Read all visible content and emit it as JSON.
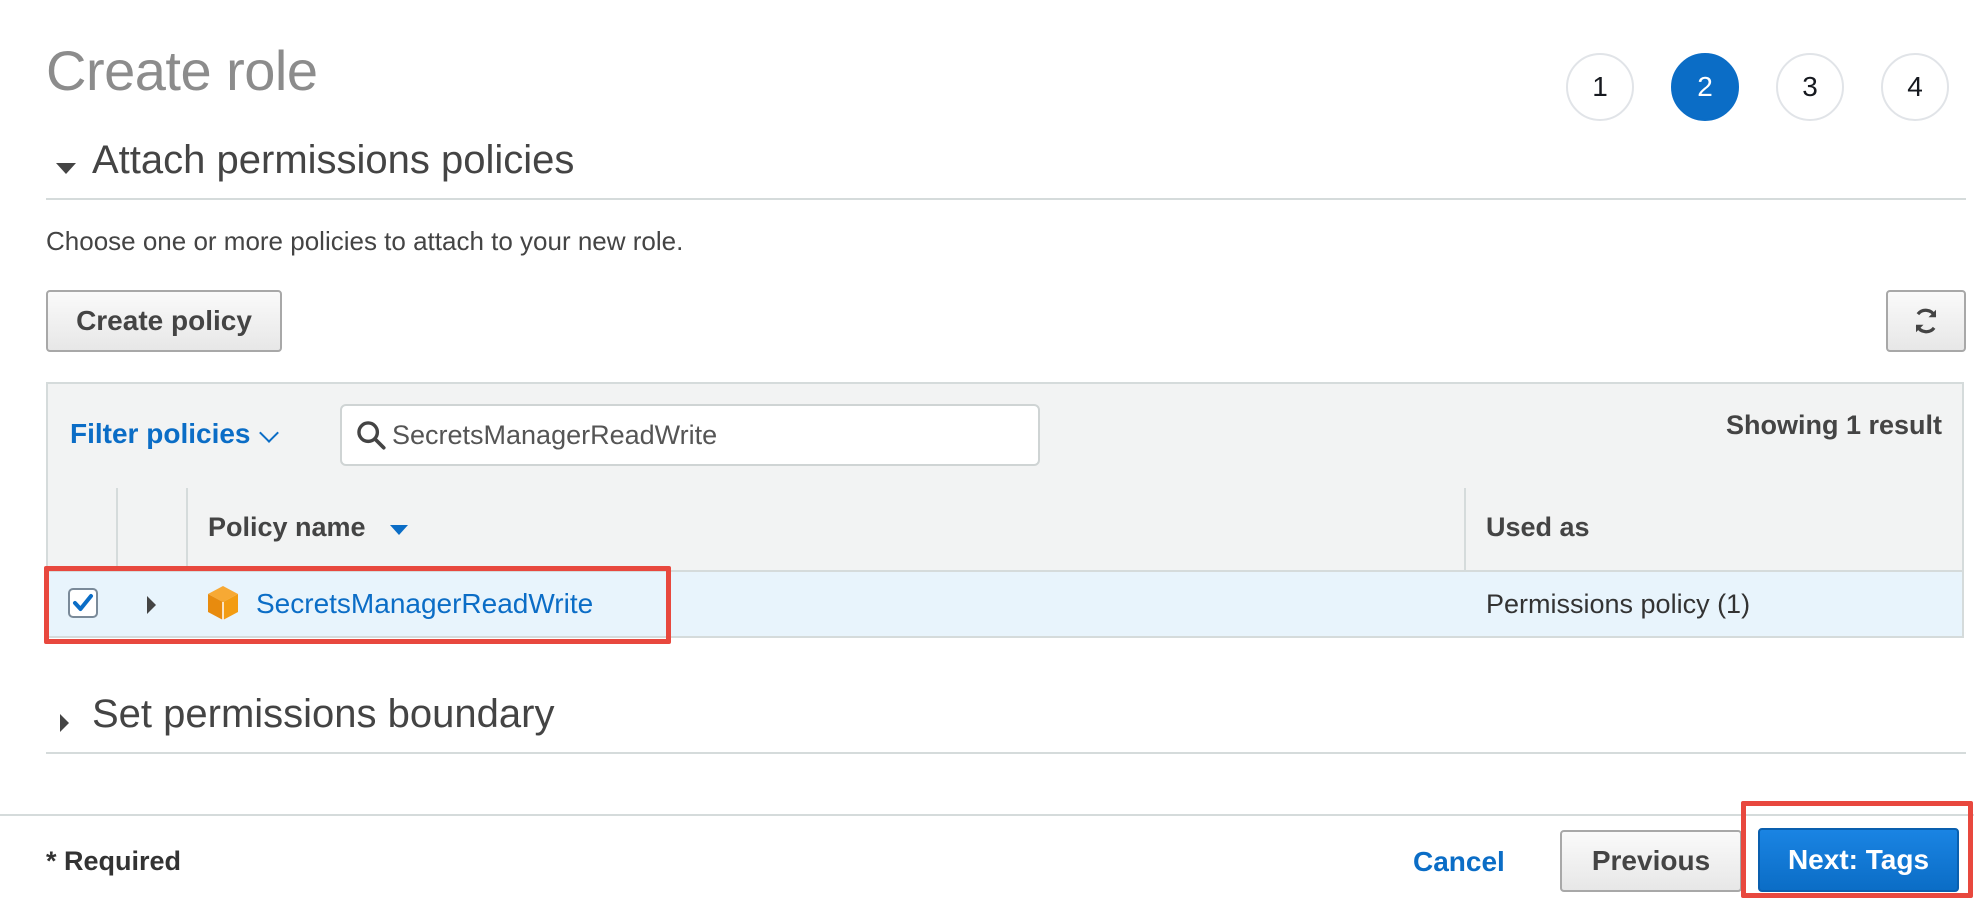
{
  "page": {
    "title": "Create role"
  },
  "steps": [
    "1",
    "2",
    "3",
    "4"
  ],
  "active_step": "2",
  "sections": {
    "attach": {
      "label": "Attach permissions policies",
      "description": "Choose one or more policies to attach to your new role."
    },
    "boundary": {
      "label": "Set permissions boundary"
    }
  },
  "toolbar": {
    "create_policy_label": "Create policy",
    "refresh_icon": "refresh-icon"
  },
  "filter": {
    "label": "Filter policies",
    "search_value": "SecretsManagerReadWrite",
    "result_text": "Showing 1 result"
  },
  "table": {
    "columns": [
      "Policy name",
      "Used as"
    ],
    "rows": [
      {
        "checked": true,
        "icon": "aws-managed-policy-cube-icon",
        "policy_name": "SecretsManagerReadWrite",
        "used_as": "Permissions policy (1)"
      }
    ]
  },
  "footer": {
    "required_label": "* Required",
    "cancel_label": "Cancel",
    "previous_label": "Previous",
    "next_label": "Next: Tags"
  },
  "colors": {
    "primary": "#0b6dc6",
    "highlight": "#e8483e",
    "row_selected": "#e8f4fc"
  }
}
